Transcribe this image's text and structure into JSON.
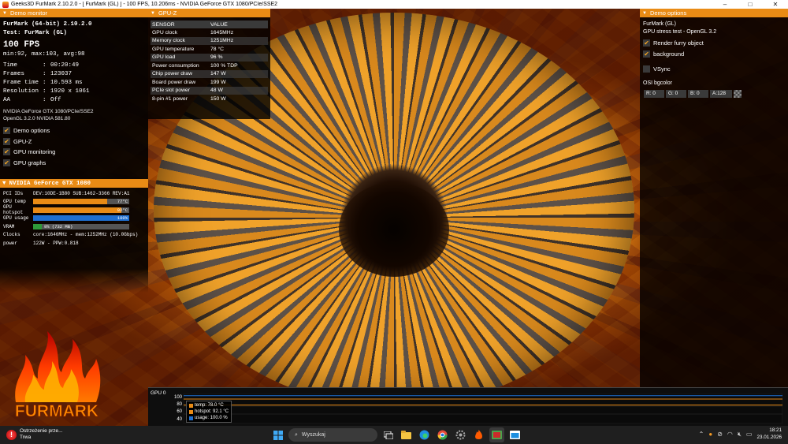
{
  "window": {
    "title": "Geeks3D FurMark 2.10.2.0 - [ FurMark (GL) ] - 100 FPS, 10.206ms - NVIDIA GeForce GTX 1080/PCIe/SSE2",
    "minimize": "–",
    "maximize": "□",
    "close": "✕"
  },
  "demo_monitor": {
    "header": "Demo monitor",
    "app_name": "FurMark (64-bit) 2.10.2.0",
    "test": "Test: FurMark (GL)",
    "fps": "100 FPS",
    "fps_stats": "min:92, max:103, avg:98",
    "stats": [
      {
        "key": "Time",
        "value": "00:20:49"
      },
      {
        "key": "Frames",
        "value": "123037"
      },
      {
        "key": "Frame time",
        "value": "10.593 ms"
      },
      {
        "key": "Resolution",
        "value": "1920 x 1061"
      },
      {
        "key": "AA",
        "value": "Off"
      }
    ],
    "renderer": "NVIDIA GeForce GTX 1080/PCIe/SSE2",
    "opengl": "OpenGL 3.2.0 NVIDIA 581.80",
    "options": [
      {
        "label": "Demo options",
        "checked": true
      },
      {
        "label": "GPU-Z",
        "checked": true
      },
      {
        "label": "GPU monitoring",
        "checked": true
      },
      {
        "label": "GPU graphs",
        "checked": true
      }
    ],
    "check_mark": "✔"
  },
  "gpu_monitor": {
    "header": "NVIDIA GeForce GTX 1080",
    "pci_label": "PCI IDs",
    "pci_value": "DEV:10DE-1B80 SUB:1462-3366 REV:A1",
    "temp_label": "GPU temp",
    "temp_value": "77°C",
    "temp_fraction": 0.77,
    "hotspot_label": "GPU hotspot",
    "hotspot_value": "92°C",
    "hotspot_fraction": 0.92,
    "usage_label": "GPU usage",
    "usage_value": "100%",
    "usage_fraction": 1.0,
    "vram_label": "VRAM",
    "vram_value": "9% (732 MB)",
    "vram_fraction": 0.09,
    "clocks_label": "Clocks",
    "clocks_value": "core:1646MHz - mem:1252MHz (10.0Gbps)",
    "power_label": "power",
    "power_value": "122W - PPW:0.818"
  },
  "logo_text": "FURMARK",
  "gpuz": {
    "header": "GPU-Z",
    "col_sensor": "SENSOR",
    "col_value": "VALUE",
    "rows": [
      {
        "sensor": "GPU clock",
        "value": "1645MHz"
      },
      {
        "sensor": "Memory clock",
        "value": "1251MHz"
      },
      {
        "sensor": "GPU temperature",
        "value": "78 °C"
      },
      {
        "sensor": "GPU load",
        "value": "96 %"
      },
      {
        "sensor": "Power consumption",
        "value": "100 % TDP"
      },
      {
        "sensor": "Chip power draw",
        "value": "147 W"
      },
      {
        "sensor": "Board power draw",
        "value": "199 W"
      },
      {
        "sensor": "PCIe slot power",
        "value": "48 W"
      },
      {
        "sensor": "8-pin #1 power",
        "value": "150 W"
      }
    ]
  },
  "demo_options": {
    "header": "Demo options",
    "title": "FurMark (GL)",
    "subtitle": "GPU stress test - OpenGL 3.2",
    "render_furry": "Render furry object",
    "background": "background",
    "vsync": "VSync",
    "osi_label": "OSI bgcolor",
    "r": "R: 0",
    "g": "G: 0",
    "b": "B: 0",
    "a": "A:128"
  },
  "graph": {
    "label": "GPU 0",
    "y_ticks": [
      "100",
      "80",
      "60",
      "40"
    ],
    "legend": [
      {
        "label": "temp: 78.0 °C",
        "color": "#e98b15"
      },
      {
        "label": "hotspot: 92.1 °C",
        "color": "#e98b15"
      },
      {
        "label": "usage: 100.0 %",
        "color": "#1e6fd0"
      }
    ],
    "series_levels": {
      "temp": 78.0,
      "hotspot": 92.1,
      "usage": 100.0
    }
  },
  "taskbar": {
    "notif_title": "Ostrzeżenie prze...",
    "notif_sub": "Trwa",
    "search_placeholder": "Wyszukaj",
    "time": "18:21",
    "date": "23.01.2026"
  },
  "colors": {
    "accent": "#e98b15",
    "usage_blue": "#1e6fd0",
    "vram_green": "#2e9a3a"
  }
}
